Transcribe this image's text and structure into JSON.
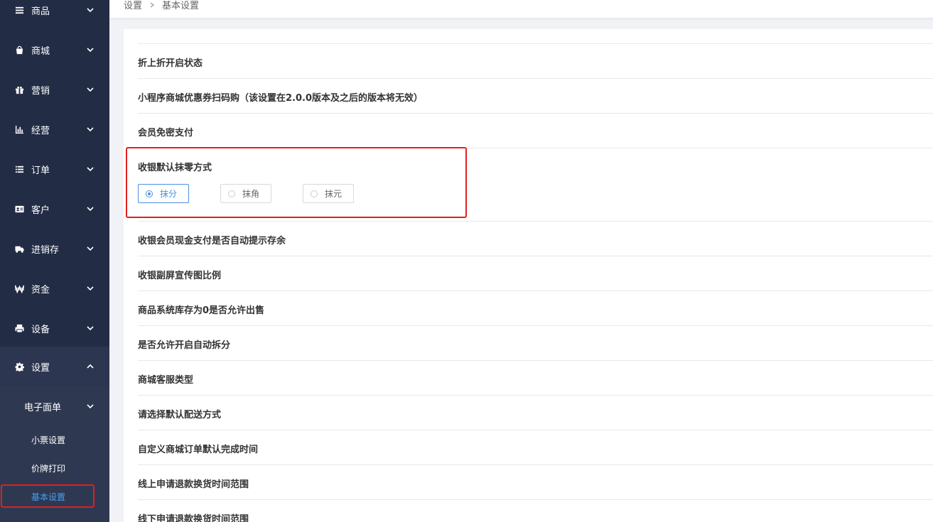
{
  "sidebar": {
    "items": [
      {
        "label": "商品",
        "icon": "list-icon"
      },
      {
        "label": "商城",
        "icon": "shopping-bag-icon"
      },
      {
        "label": "营销",
        "icon": "gift-icon"
      },
      {
        "label": "经营",
        "icon": "bar-chart-icon"
      },
      {
        "label": "订单",
        "icon": "list-lines-icon"
      },
      {
        "label": "客户",
        "icon": "id-card-icon"
      },
      {
        "label": "进销存",
        "icon": "truck-icon"
      },
      {
        "label": "资金",
        "icon": "currency-icon"
      },
      {
        "label": "设备",
        "icon": "printer-icon"
      },
      {
        "label": "设置",
        "icon": "gear-icon"
      }
    ],
    "submenu": {
      "head": "电子面单",
      "items": [
        "小票设置",
        "价牌打印",
        "基本设置"
      ]
    }
  },
  "breadcrumb": {
    "root": "设置",
    "current": "基本设置"
  },
  "settings": {
    "rows": [
      "折上折开启状态",
      "小程序商城优惠券扫码购（该设置在2.0.0版本及之后的版本将无效）",
      "会员免密支付",
      "收银默认抹零方式",
      "收银会员现金支付是否自动提示存余",
      "收银副屏宣传图比例",
      "商品系统库存为0是否允许出售",
      "是否允许开启自动拆分",
      "商城客服类型",
      "请选择默认配送方式",
      "自定义商城订单默认完成时间",
      "线上申请退款换货时间范围",
      "线下申请退款换货时间范围"
    ],
    "rounding_options": [
      "抹分",
      "抹角",
      "抹元"
    ],
    "rounding_selected": "抹分"
  },
  "colors": {
    "sidebar_bg": "#222d45",
    "accent": "#4a90e2",
    "highlight": "#e02020"
  }
}
